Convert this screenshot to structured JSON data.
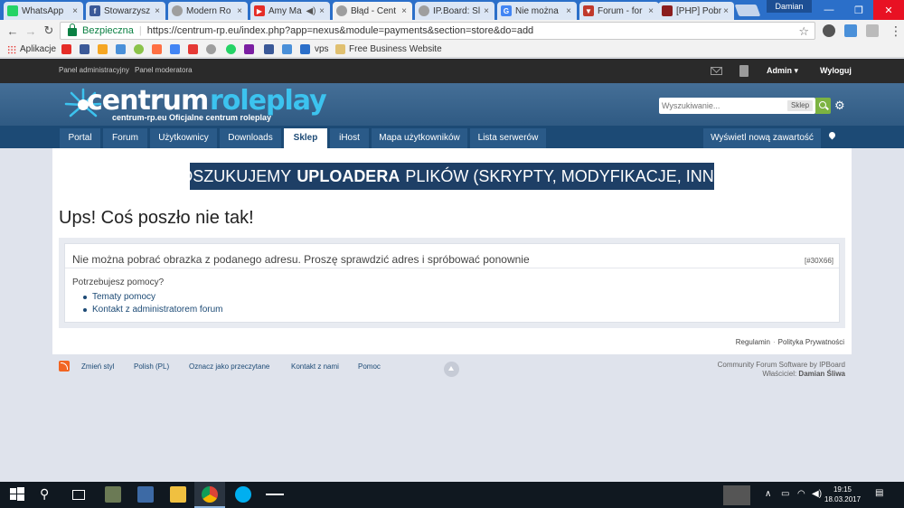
{
  "browser": {
    "tabs": [
      {
        "title": "WhatsApp",
        "icon": "whatsapp-icon",
        "color": "#25d366",
        "active": false
      },
      {
        "title": "Stowarzysz",
        "icon": "facebook-icon",
        "color": "#3b5998",
        "active": false
      },
      {
        "title": "Modern Ro",
        "icon": "ipb-icon",
        "color": "#9e9e9e",
        "active": false
      },
      {
        "title": "Amy Ma",
        "icon": "youtube-icon",
        "color": "#e52d27",
        "active": false
      },
      {
        "title": "Błąd - Cent",
        "icon": "ipb-icon",
        "color": "#9e9e9e",
        "active": true
      },
      {
        "title": "IP.Board: Sl",
        "icon": "ipb-icon",
        "color": "#9e9e9e",
        "active": false
      },
      {
        "title": "Nie można",
        "icon": "google-icon",
        "color": "#4285f4",
        "active": false
      },
      {
        "title": "Forum - for",
        "icon": "forum-icon",
        "color": "#c0392b",
        "active": false
      },
      {
        "title": "[PHP] Pobr",
        "icon": "php-icon",
        "color": "#8b1e1e",
        "active": false
      }
    ],
    "tab_close": "×",
    "user_badge": "Damian",
    "window_controls": {
      "minimize": "—",
      "maximize": "❐",
      "close": "✕"
    },
    "address": {
      "secure_label": "Bezpieczna",
      "url": "https://centrum-rp.eu/index.php?app=nexus&module=payments&section=store&do=add"
    },
    "bookmarks": {
      "apps_label": "Aplikacje",
      "vps_label": "vps",
      "business_label": "Free Business Website"
    }
  },
  "adminbar": {
    "acp_label": "Panel administracyjny",
    "mod_label": "Panel moderatora",
    "user_label": "Admin ▾",
    "logout_label": "Wyloguj"
  },
  "header": {
    "logo_word1": "centrum",
    "logo_word2": "roleplay",
    "tagline": "centrum-rp.eu  Oficjalne centrum roleplay",
    "search_placeholder": "Wyszukiwanie...",
    "search_scope": "Sklep"
  },
  "nav": {
    "items": [
      "Portal",
      "Forum",
      "Użytkownicy",
      "Downloads",
      "Sklep",
      "iHost",
      "Mapa użytkowników",
      "Lista serwerów"
    ],
    "active": "Sklep",
    "new_content": "Wyświetl nową zawartość"
  },
  "content": {
    "banner_pre": "POSZUKUJEMY",
    "banner_bold": "UPLOADERA",
    "banner_post": "PLIKÓW (SKRYPTY, MODYFIKACJE, INNE )",
    "error_title": "Ups! Coś poszło nie tak!",
    "error_message": "Nie można pobrać obrazka z podanego adresu. Proszę sprawdzić adres i spróbować ponownie",
    "error_code": "[#30X66]",
    "help_question": "Potrzebujesz pomocy?",
    "help_links": [
      "Tematy pomocy",
      "Kontakt z administratorem forum"
    ],
    "footer_links": [
      "Regulamin",
      "Polityka Prywatności"
    ]
  },
  "footer": {
    "links": [
      "Zmień styl",
      "Polish (PL)",
      "Oznacz jako przeczytane",
      "Kontakt z nami",
      "Pomoc"
    ],
    "credits_line1": "Community Forum Software by IPBoard",
    "credits_owner_label": "Właściciel:",
    "credits_owner": "Damian Śliwa"
  },
  "taskbar": {
    "time": "19:15",
    "date": "18.03.2017"
  }
}
